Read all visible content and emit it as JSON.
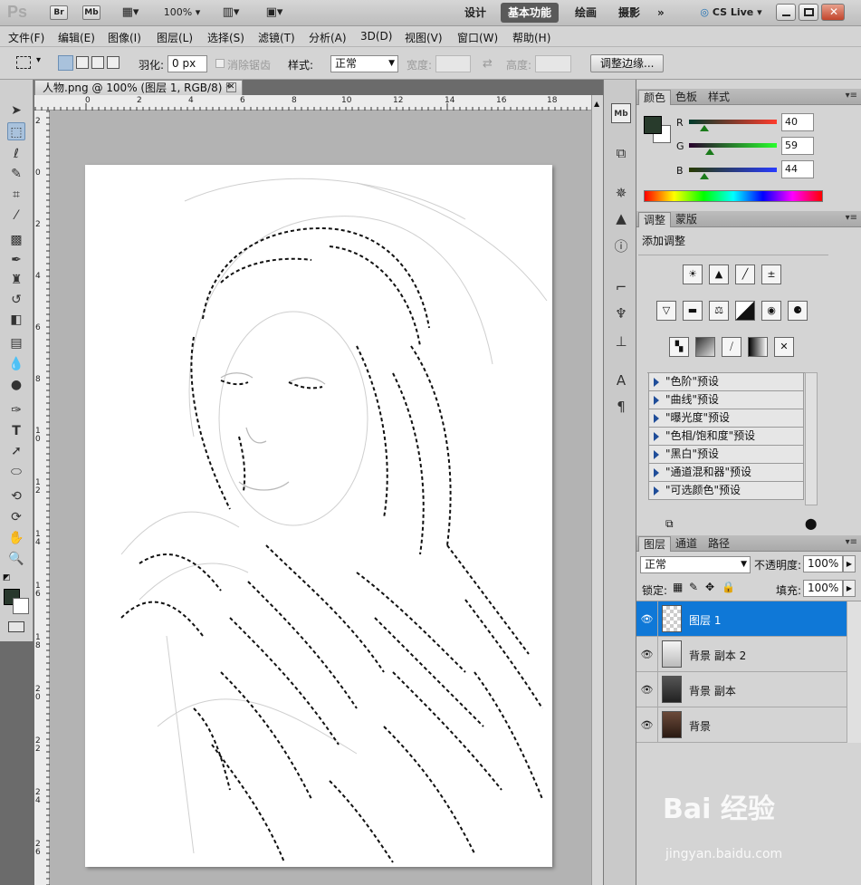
{
  "app": {
    "logo": "Ps",
    "bridge_label": "Br",
    "minibridge_label": "Mb",
    "zoom": "100%",
    "workspaces": [
      "设计",
      "基本功能",
      "绘画",
      "摄影"
    ],
    "more": "»",
    "cs_live": "CS Live"
  },
  "menu": [
    "文件(F)",
    "编辑(E)",
    "图像(I)",
    "图层(L)",
    "选择(S)",
    "滤镜(T)",
    "分析(A)",
    "3D(D)",
    "视图(V)",
    "窗口(W)",
    "帮助(H)"
  ],
  "options": {
    "feather_label": "羽化:",
    "feather_value": "0 px",
    "antialias_label": "消除锯齿",
    "style_label": "样式:",
    "style_value": "正常",
    "width_label": "宽度:",
    "height_label": "高度:",
    "refine_button": "调整边缘..."
  },
  "document": {
    "tab_title": "人物.png @ 100% (图层 1, RGB/8) *",
    "ruler_h": [
      "0",
      "2",
      "4",
      "6",
      "8",
      "10",
      "12",
      "14",
      "16",
      "18"
    ],
    "ruler_v": [
      "2",
      "0",
      "2",
      "4",
      "6",
      "8",
      "1\n0",
      "1\n2",
      "1\n4",
      "1\n6",
      "1\n8",
      "2\n0",
      "2\n2",
      "2\n4",
      "2\n6"
    ]
  },
  "color_panel": {
    "tabs": [
      "颜色",
      "色板",
      "样式"
    ],
    "r_label": "R",
    "g_label": "G",
    "b_label": "B",
    "r": "40",
    "g": "59",
    "b": "44",
    "fg_color": "#283B2C"
  },
  "adjust_panel": {
    "tabs": [
      "调整",
      "蒙版"
    ],
    "title": "添加调整",
    "presets": [
      "\"色阶\"预设",
      "\"曲线\"预设",
      "\"曝光度\"预设",
      "\"色相/饱和度\"预设",
      "\"黑白\"预设",
      "\"通道混和器\"预设",
      "\"可选颜色\"预设"
    ]
  },
  "layers_panel": {
    "tabs": [
      "图层",
      "通道",
      "路径"
    ],
    "blend_mode": "正常",
    "opacity_label": "不透明度:",
    "opacity": "100%",
    "lock_label": "锁定:",
    "fill_label": "填充:",
    "fill": "100%",
    "layers": [
      "图层 1",
      "背景 副本 2",
      "背景 副本",
      "背景"
    ]
  },
  "watermark": {
    "brand": "Bai  经验",
    "url": "jingyan.baidu.com"
  }
}
